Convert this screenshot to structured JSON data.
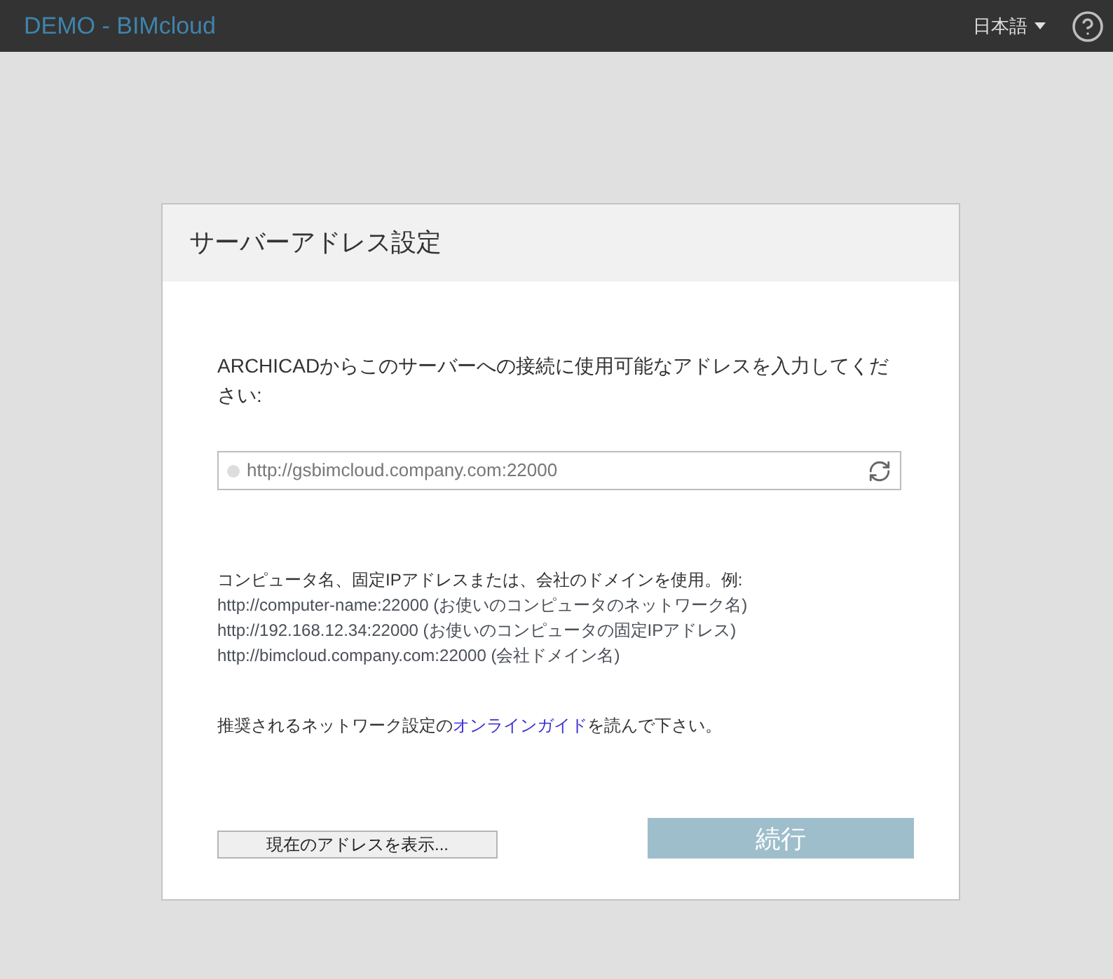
{
  "app_bar": {
    "title": "DEMO - BIMcloud",
    "language": "日本語"
  },
  "dialog": {
    "title": "サーバーアドレス設定",
    "instruction": "ARCHICADからこのサーバーへの接続に使用可能なアドレスを入力してください:",
    "address_field": {
      "value": "http://gsbimcloud.company.com:22000"
    },
    "hint": "コンピュータ名、固定IPアドレスまたは、会社のドメインを使用。例:",
    "examples": [
      "http://computer-name:22000 (お使いのコンピュータのネットワーク名)",
      "http://192.168.12.34:22000 (お使いのコンピュータの固定IPアドレス)",
      "http://bimcloud.company.com:22000 (会社ドメイン名)"
    ],
    "guide": {
      "before": "推奨されるネットワーク設定の",
      "link": "オンラインガイド",
      "after": "を読んで下さい。"
    },
    "buttons": [
      {
        "kind": "secondary",
        "label": "現在のアドレスを表示...",
        "disabled": false
      },
      {
        "kind": "primary",
        "label": "続行",
        "disabled": true
      }
    ]
  }
}
